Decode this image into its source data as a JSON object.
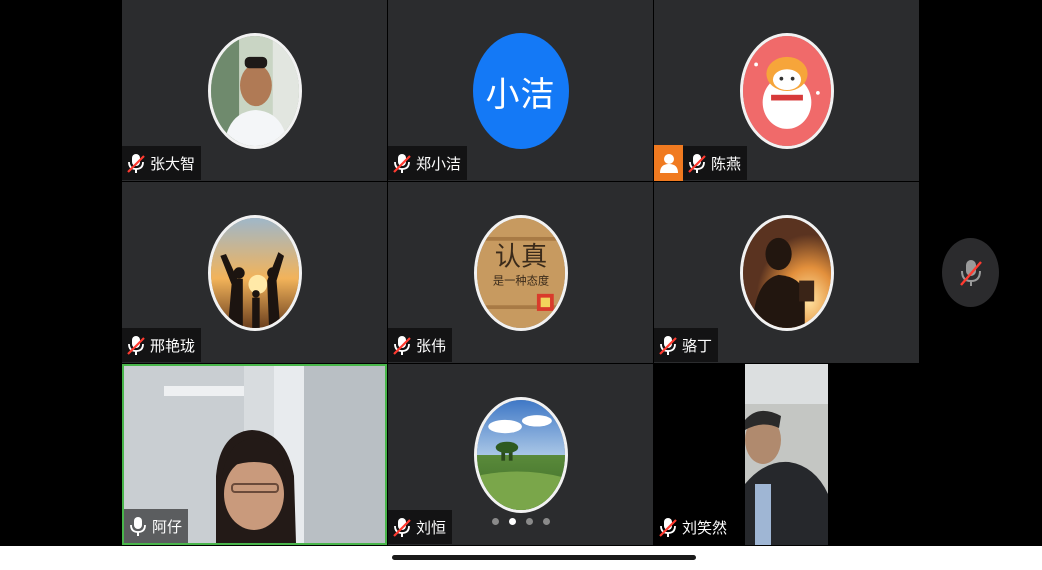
{
  "participants": [
    {
      "name": "张大智",
      "avatar": "photo-young-man",
      "mic_icon": "mic-muted-icon"
    },
    {
      "name": "郑小洁",
      "avatar_text": "小洁",
      "avatar_color": "#1479f6",
      "mic_icon": "mic-muted-icon"
    },
    {
      "name": "陈燕",
      "avatar": "cartoon-tiger",
      "is_host": true,
      "mic_icon": "mic-muted-icon"
    },
    {
      "name": "邢艳珑",
      "avatar": "sunset-family-silhouette",
      "mic_icon": "mic-muted-icon"
    },
    {
      "name": "张伟",
      "avatar": "slogan-wood",
      "avatar_lines": [
        "认真",
        "是一种态度"
      ],
      "mic_icon": "mic-muted-icon"
    },
    {
      "name": "骆丁",
      "avatar": "silhouette-reading",
      "mic_icon": "mic-muted-icon"
    },
    {
      "name": "阿仔",
      "video": "self-camera",
      "active_speaker": true,
      "mic_icon": "mic-on-icon"
    },
    {
      "name": "刘恒",
      "avatar": "grassland-landscape",
      "mic_icon": "mic-muted-icon"
    },
    {
      "name": "刘笑然",
      "video": "remote-camera",
      "mic_icon": "mic-muted-icon"
    }
  ],
  "pagination": {
    "pages": 4,
    "current": 2
  },
  "controls": {
    "floating_mic": "mic-muted-icon"
  },
  "colors": {
    "tile_bg": "#2b2c2e",
    "active_speaker_border": "#49b64b",
    "host_badge": "#f07a20",
    "mute_red": "#ff3b30"
  }
}
